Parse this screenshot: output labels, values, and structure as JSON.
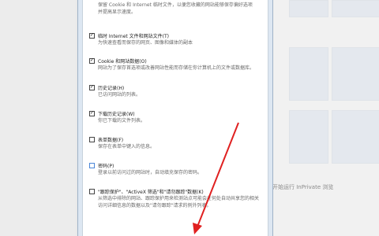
{
  "dialog": {
    "top_description": "保留 Cookie 和 Internet 临时文件，以便您收藏的网站能够保存偏好选项并提高显示速度。",
    "options": [
      {
        "label": "临时 Internet 文件和网站文件(T)",
        "checked": true,
        "desc": "为快速查看而保存的网页、图像和媒体的副本"
      },
      {
        "label": "Cookie 和网站数据(O)",
        "checked": true,
        "desc": "网站为了保存首选项或改善网站性能而存储在你计算机上的文件或数据库。"
      },
      {
        "label": "历史记录(H)",
        "checked": true,
        "desc": "已访问网站的列表。"
      },
      {
        "label": "下载历史记录(W)",
        "checked": true,
        "desc": "你已下载的文件列表。"
      },
      {
        "label": "表单数据(F)",
        "checked": false,
        "desc": "保存在表单中键入的信息。"
      },
      {
        "label": "密码(P)",
        "checked": false,
        "desc": "登录以前访问过的网站时，自动填充保存的密码。"
      },
      {
        "label": "\"跟踪保护\"、\"ActiveX 筛选\"和\"请勿跟踪\"数据(K)",
        "checked": false,
        "desc": "从筛选中排除的网站、跟踪保护用来检测站点可能会在何处自动共享您的相关访问详细信息的数据以及\"请勿跟踪\"请求的例外列表。"
      }
    ]
  },
  "background": {
    "inprivate_text": "开始运行 InPrivate 浏览"
  },
  "annotation": {
    "color": "#e02020"
  }
}
